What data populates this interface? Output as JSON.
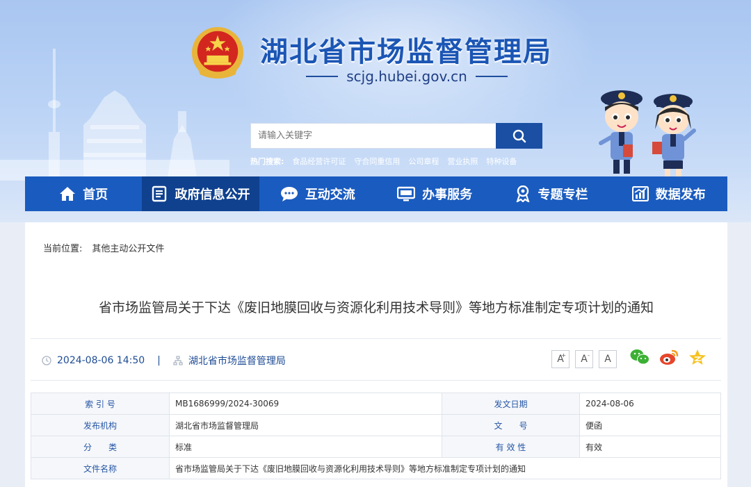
{
  "site": {
    "title": "湖北省市场监督管理局",
    "url": "scjg.hubei.gov.cn"
  },
  "search": {
    "placeholder": "请输入关键字",
    "hot_label": "热门搜索:",
    "hot_terms": [
      "食品经营许可证",
      "守合同重信用",
      "公司章程",
      "营业执照",
      "特种设备"
    ]
  },
  "nav": {
    "items": [
      {
        "label": "首页",
        "icon": "home-icon"
      },
      {
        "label": "政府信息公开",
        "icon": "document-icon",
        "active": true
      },
      {
        "label": "互动交流",
        "icon": "chat-icon"
      },
      {
        "label": "办事服务",
        "icon": "monitor-icon"
      },
      {
        "label": "专题专栏",
        "icon": "badge-icon"
      },
      {
        "label": "数据发布",
        "icon": "chart-icon"
      }
    ]
  },
  "breadcrumb": {
    "prefix": "当前位置:",
    "current": "其他主动公开文件"
  },
  "article": {
    "title": "省市场监管局关于下达《废旧地膜回收与资源化利用技术导则》等地方标准制定专项计划的通知",
    "datetime": "2024-08-06 14:50",
    "separator": "|",
    "source": "湖北省市场监督管理局"
  },
  "font_controls": [
    "A",
    "A",
    "A"
  ],
  "info_table": {
    "rows": [
      {
        "l1": "索 引 号",
        "v1": "MB1686999/2024-30069",
        "l2": "发文日期",
        "v2": "2024-08-06"
      },
      {
        "l1": "发布机构",
        "v1": "湖北省市场监督管理局",
        "l2": "文　　号",
        "v2": "便函"
      },
      {
        "l1": "分　　类",
        "v1": "标准",
        "l2": "有 效 性",
        "v2": "有效"
      }
    ],
    "name_label": "文件名称",
    "name_value": "省市场监管局关于下达《废旧地膜回收与资源化利用技术导则》等地方标准制定专项计划的通知"
  },
  "colors": {
    "nav_bg": "#1a5bbf",
    "nav_active": "#0f418f",
    "title_blue": "#1b56b5",
    "label_blue": "#2656a6"
  }
}
